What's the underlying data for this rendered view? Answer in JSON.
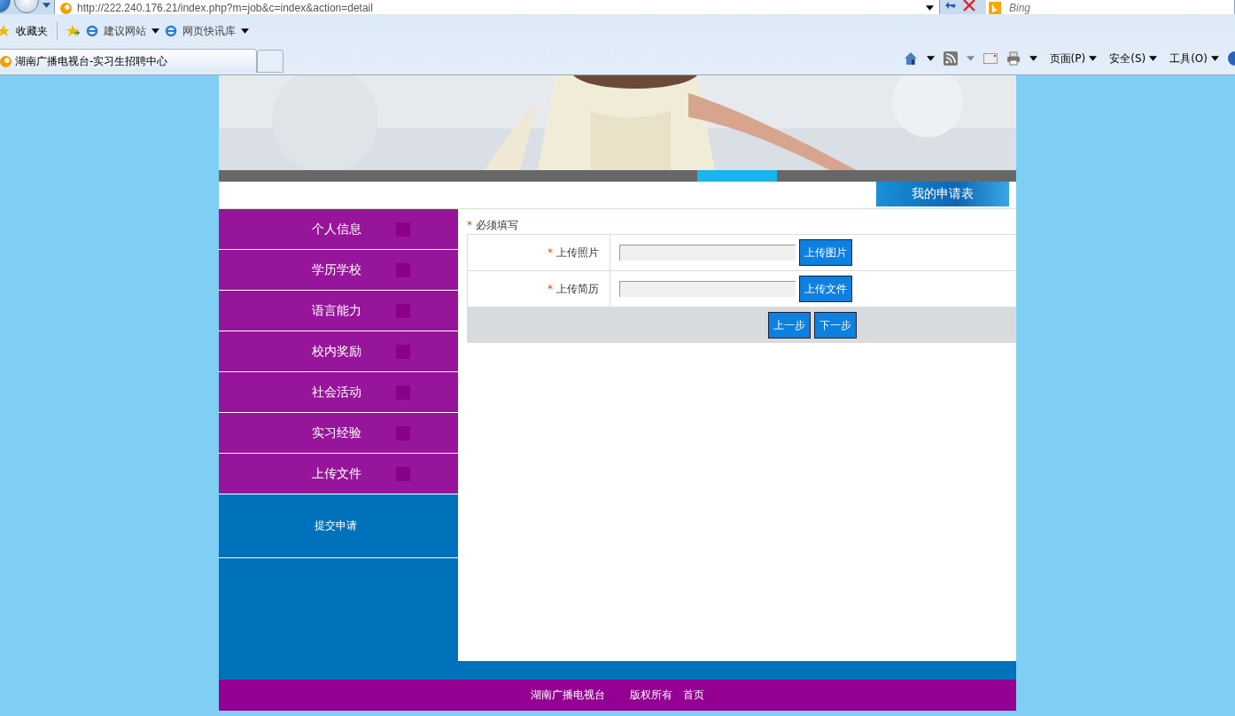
{
  "browser": {
    "address": "http://222.240.176.21/index.php?m=job&c=index&action=detail",
    "search_placeholder": "Bing",
    "favorites": "收藏夹",
    "links": [
      "建议网站",
      "网页快讯库"
    ],
    "tab_title": "湖南广播电视台-实习生招聘中心",
    "commands": [
      "页面(P)",
      "安全(S)",
      "工具(O)"
    ]
  },
  "page": {
    "header_tab": "我的申请表",
    "nav": [
      "个人信息",
      "学历学校",
      "语言能力",
      "校内奖励",
      "社会活动",
      "实习经验",
      "上传文件"
    ],
    "submit": "提交申请",
    "form": {
      "required_mark": "*",
      "required_note": "必须填写",
      "rows": [
        {
          "label": "上传照片",
          "button": "上传图片"
        },
        {
          "label": "上传简历",
          "button": "上传文件"
        }
      ],
      "steps": [
        "上一步",
        "下一步"
      ]
    },
    "footer": [
      "湖南广播电视台",
      "版权所有",
      "首页"
    ]
  }
}
